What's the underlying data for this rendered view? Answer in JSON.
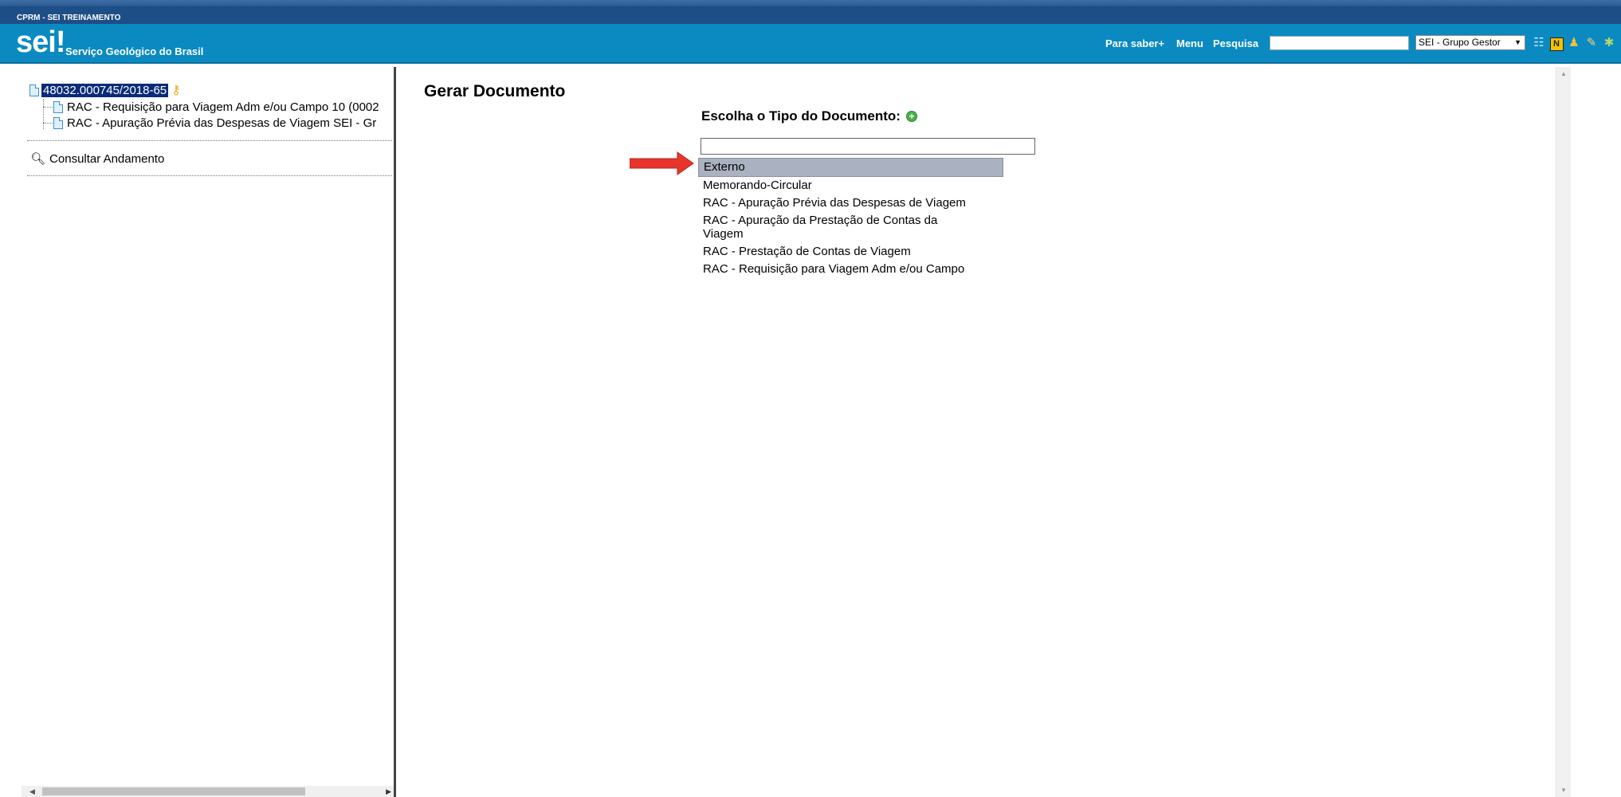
{
  "env": {
    "label": "CPRM - SEI TREINAMENTO"
  },
  "header": {
    "logo": "sei!",
    "org": "Serviço Geológico do Brasil",
    "links": {
      "saber": "Para saber+",
      "menu": "Menu",
      "pesquisa": "Pesquisa"
    },
    "search_value": "",
    "unit_select": "SEI - Grupo Gestor",
    "icons": [
      "list-icon",
      "notes-icon",
      "user-icon",
      "tools-icon",
      "exit-icon"
    ],
    "colors": {
      "bar": "#0a8ac1",
      "env_bar": "#1e4e86"
    }
  },
  "tree": {
    "process_id": "48032.000745/2018-65",
    "items": [
      {
        "label": "RAC - Requisição para Viagem Adm e/ou Campo 10 (0002"
      },
      {
        "label": "RAC - Apuração Prévia das Despesas de Viagem SEI - Gr"
      }
    ],
    "consultar": "Consultar Andamento"
  },
  "main": {
    "title": "Gerar Documento",
    "choose_label": "Escolha o Tipo do Documento:",
    "filter_value": "",
    "options": [
      {
        "label": "Externo",
        "selected": true
      },
      {
        "label": "Memorando-Circular",
        "selected": false
      },
      {
        "label": "RAC - Apuração Prévia das Despesas de Viagem",
        "selected": false
      },
      {
        "label": "RAC - Apuração da Prestação de Contas da Viagem",
        "selected": false
      },
      {
        "label": "RAC - Prestação de Contas de Viagem",
        "selected": false
      },
      {
        "label": "RAC - Requisição para Viagem Adm e/ou Campo",
        "selected": false
      }
    ],
    "annotation_color": "#e8352b"
  }
}
